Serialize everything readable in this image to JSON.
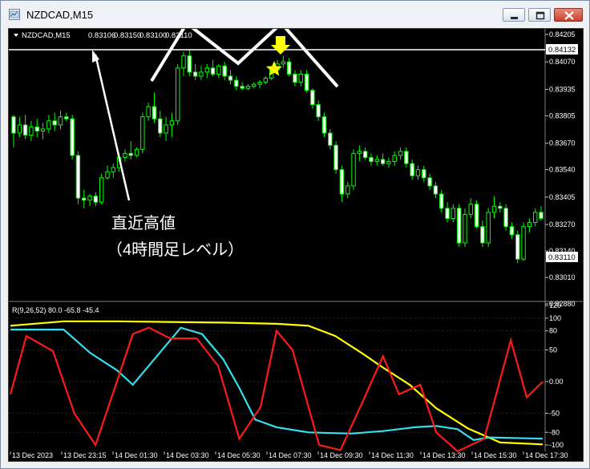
{
  "window": {
    "title": "NZDCAD,M15"
  },
  "chart_info": {
    "label": "NZDCAD,M15",
    "ohlc": [
      "0.83106",
      "0.83150",
      "0.83100",
      "0.83110"
    ]
  },
  "price_axis": {
    "ticks": [
      "0.84205",
      "0.84070",
      "0.83935",
      "0.83805",
      "0.83670",
      "0.83540",
      "0.83405",
      "0.83270",
      "0.83140",
      "0.83010",
      "0.82880"
    ],
    "high_label": "0.84132",
    "current_label": "0.83110"
  },
  "indicator": {
    "label": "R(9,26,52) 80.0 -65.8 -45.4",
    "ticks": [
      "120",
      "100",
      "80",
      "50",
      "0.00",
      "-50",
      "-80",
      "-100"
    ]
  },
  "time_axis": {
    "labels": [
      "13 Dec 2023",
      "13 Dec 23:15",
      "14 Dec 01:30",
      "14 Dec 03:30",
      "14 Dec 05:30",
      "14 Dec 07:30",
      "14 Dec 09:30",
      "14 Dec 11:30",
      "14 Dec 13:30",
      "14 Dec 15:30",
      "14 Dec 17:30"
    ]
  },
  "annotation": {
    "line1": "直近高値",
    "line2": "（4時間足レベル）"
  },
  "colors": {
    "candle": "#00ff00",
    "background": "#000000",
    "fast_line": "#ff1a1a",
    "mid_line": "#33e0f0",
    "slow_line": "#ffff00",
    "marker": "#ffff00"
  },
  "chart_data": {
    "type": "candlestick",
    "symbol": "NZDCAD",
    "timeframe": "M15",
    "y_range": [
      0.8288,
      0.8422
    ],
    "candles": [
      [
        0.838,
        0.8381,
        0.8365,
        0.8372
      ],
      [
        0.8372,
        0.838,
        0.837,
        0.8376
      ],
      [
        0.8376,
        0.8381,
        0.8369,
        0.8371
      ],
      [
        0.8371,
        0.8378,
        0.8368,
        0.8375
      ],
      [
        0.8375,
        0.8379,
        0.837,
        0.8373
      ],
      [
        0.8373,
        0.8377,
        0.8369,
        0.8374
      ],
      [
        0.8374,
        0.8381,
        0.8372,
        0.8378
      ],
      [
        0.8378,
        0.8382,
        0.8373,
        0.8376
      ],
      [
        0.8376,
        0.8383,
        0.8374,
        0.838
      ],
      [
        0.838,
        0.8382,
        0.8378,
        0.8379
      ],
      [
        0.8379,
        0.8381,
        0.8359,
        0.8361
      ],
      [
        0.8361,
        0.8363,
        0.8337,
        0.834
      ],
      [
        0.834,
        0.8344,
        0.8335,
        0.8339
      ],
      [
        0.8339,
        0.8342,
        0.8336,
        0.8341
      ],
      [
        0.8341,
        0.8343,
        0.8336,
        0.8338
      ],
      [
        0.8338,
        0.8352,
        0.8337,
        0.835
      ],
      [
        0.835,
        0.8356,
        0.8349,
        0.8353
      ],
      [
        0.8353,
        0.8357,
        0.835,
        0.8355
      ],
      [
        0.8355,
        0.8362,
        0.8353,
        0.836
      ],
      [
        0.836,
        0.8364,
        0.8358,
        0.8362
      ],
      [
        0.8362,
        0.8368,
        0.8359,
        0.8361
      ],
      [
        0.8361,
        0.8365,
        0.836,
        0.8364
      ],
      [
        0.8364,
        0.8382,
        0.8362,
        0.838
      ],
      [
        0.838,
        0.8387,
        0.8378,
        0.8385
      ],
      [
        0.8385,
        0.8392,
        0.8377,
        0.8379
      ],
      [
        0.8379,
        0.8383,
        0.837,
        0.8372
      ],
      [
        0.8372,
        0.838,
        0.8368,
        0.8376
      ],
      [
        0.8376,
        0.8382,
        0.837,
        0.8378
      ],
      [
        0.8378,
        0.8406,
        0.8376,
        0.8404
      ],
      [
        0.8404,
        0.8412,
        0.84,
        0.841
      ],
      [
        0.841,
        0.8413,
        0.84,
        0.8402
      ],
      [
        0.8402,
        0.8406,
        0.8398,
        0.84
      ],
      [
        0.84,
        0.8405,
        0.8398,
        0.8402
      ],
      [
        0.8402,
        0.8406,
        0.8399,
        0.8404
      ],
      [
        0.8404,
        0.8408,
        0.84,
        0.8401
      ],
      [
        0.8401,
        0.8406,
        0.8399,
        0.8405
      ],
      [
        0.8405,
        0.8407,
        0.8398,
        0.84
      ],
      [
        0.84,
        0.8403,
        0.8396,
        0.8398
      ],
      [
        0.8398,
        0.84,
        0.8393,
        0.8395
      ],
      [
        0.8395,
        0.8397,
        0.8393,
        0.8394
      ],
      [
        0.8394,
        0.8396,
        0.8393,
        0.8395
      ],
      [
        0.8395,
        0.8397,
        0.8394,
        0.8396
      ],
      [
        0.8396,
        0.8398,
        0.8394,
        0.8397
      ],
      [
        0.8397,
        0.84,
        0.8396,
        0.8399
      ],
      [
        0.8399,
        0.8404,
        0.8398,
        0.8403
      ],
      [
        0.8403,
        0.8408,
        0.8401,
        0.8406
      ],
      [
        0.8406,
        0.841,
        0.8404,
        0.8407
      ],
      [
        0.8407,
        0.8409,
        0.84,
        0.8401
      ],
      [
        0.8401,
        0.8403,
        0.8395,
        0.8397
      ],
      [
        0.8397,
        0.8403,
        0.8395,
        0.8401
      ],
      [
        0.8401,
        0.8403,
        0.8392,
        0.8393
      ],
      [
        0.8393,
        0.8394,
        0.8384,
        0.8386
      ],
      [
        0.8386,
        0.8388,
        0.8378,
        0.838
      ],
      [
        0.838,
        0.8382,
        0.837,
        0.8372
      ],
      [
        0.8372,
        0.8374,
        0.8364,
        0.8366
      ],
      [
        0.8366,
        0.8368,
        0.8352,
        0.8354
      ],
      [
        0.8354,
        0.8356,
        0.8338,
        0.8342
      ],
      [
        0.8342,
        0.8348,
        0.834,
        0.8346
      ],
      [
        0.8346,
        0.8364,
        0.8344,
        0.8362
      ],
      [
        0.8362,
        0.8366,
        0.8358,
        0.8363
      ],
      [
        0.8363,
        0.8365,
        0.8359,
        0.836
      ],
      [
        0.836,
        0.8362,
        0.8356,
        0.8358
      ],
      [
        0.8358,
        0.8361,
        0.8356,
        0.8359
      ],
      [
        0.8359,
        0.8362,
        0.8356,
        0.8357
      ],
      [
        0.8357,
        0.836,
        0.8355,
        0.8358
      ],
      [
        0.8358,
        0.8363,
        0.8356,
        0.8361
      ],
      [
        0.8361,
        0.8365,
        0.8359,
        0.8363
      ],
      [
        0.8363,
        0.8365,
        0.8355,
        0.8357
      ],
      [
        0.8357,
        0.8359,
        0.8349,
        0.8351
      ],
      [
        0.8351,
        0.8356,
        0.8349,
        0.8354
      ],
      [
        0.8354,
        0.8356,
        0.8348,
        0.835
      ],
      [
        0.835,
        0.8352,
        0.8344,
        0.8346
      ],
      [
        0.8346,
        0.8348,
        0.834,
        0.8342
      ],
      [
        0.8342,
        0.8344,
        0.8333,
        0.8335
      ],
      [
        0.8335,
        0.8338,
        0.8328,
        0.833
      ],
      [
        0.833,
        0.8337,
        0.8328,
        0.8335
      ],
      [
        0.8335,
        0.8337,
        0.8316,
        0.8318
      ],
      [
        0.8318,
        0.8335,
        0.8316,
        0.8332
      ],
      [
        0.8332,
        0.834,
        0.833,
        0.8337
      ],
      [
        0.8337,
        0.8339,
        0.8325,
        0.8326
      ],
      [
        0.8326,
        0.8329,
        0.8316,
        0.8318
      ],
      [
        0.8318,
        0.8335,
        0.8316,
        0.8333
      ],
      [
        0.8333,
        0.8341,
        0.833,
        0.8336
      ],
      [
        0.8336,
        0.8338,
        0.8333,
        0.8335
      ],
      [
        0.8335,
        0.8337,
        0.8324,
        0.8326
      ],
      [
        0.8326,
        0.8328,
        0.832,
        0.8322
      ],
      [
        0.8322,
        0.8324,
        0.8308,
        0.831
      ],
      [
        0.831,
        0.8328,
        0.8309,
        0.8326
      ],
      [
        0.8326,
        0.833,
        0.8323,
        0.8328
      ],
      [
        0.8328,
        0.8335,
        0.8326,
        0.8333
      ],
      [
        0.8333,
        0.8336,
        0.8329,
        0.833
      ]
    ],
    "indicator_range": [
      -110,
      120
    ],
    "indicator_series": [
      {
        "x": [
          0,
          0.05,
          0.12,
          0.2,
          0.28,
          0.36,
          0.4,
          0.44,
          0.48,
          0.52,
          0.56,
          0.6,
          0.64,
          0.68,
          0.72,
          0.78,
          0.82,
          0.86,
          0.9,
          0.94,
          0.98,
          1.02,
          1.06,
          1.1,
          1.14,
          1.18,
          1.22,
          1.26,
          1.3,
          1.34,
          1.38,
          1.42,
          1.46,
          1.5,
          1.54,
          1.58,
          1.62,
          1.66,
          1.7,
          1.74,
          1.78,
          1.82,
          1.86,
          1.9,
          1.94,
          1.98,
          2.02,
          2.06,
          2.1,
          2.14,
          2.18,
          2.22,
          2.26,
          2.3,
          2.34,
          2.38,
          2.42,
          2.46,
          2.5,
          2.54,
          2.58,
          2.62,
          2.66,
          2.7,
          2.74,
          2.78,
          2.82,
          2.86,
          2.9,
          2.94,
          2.98,
          3.02,
          3.06,
          3.1,
          3.14,
          3.18,
          3.22,
          3.26,
          3.3,
          3.34,
          3.38,
          3.42,
          3.46,
          3.5,
          3.54,
          3.58,
          3.62,
          3.66,
          3.7,
          3.74,
          3.78,
          3.82,
          3.86,
          3.9,
          3.94,
          3.98,
          4.02,
          4.06,
          4.1,
          4.14,
          4.18,
          4.22,
          4.26,
          4.3,
          4.34,
          4.38,
          4.42,
          4.46,
          4.5,
          4.54,
          4.58,
          4.62,
          4.66,
          4.7,
          4.74,
          4.78,
          4.82,
          4.86,
          4.9,
          4.94,
          4.98,
          5.02,
          5.06,
          5.1,
          5.14,
          5.18,
          5.22,
          5.26,
          5.3,
          5.34,
          5.38,
          5.42,
          5.46,
          5.5,
          5.54,
          5.58,
          5.62,
          5.66,
          5.7,
          5.74,
          5.78,
          5.82,
          5.86,
          5.9,
          5.94,
          5.98,
          6.02,
          6.06,
          6.1,
          6.14,
          6.18,
          6.22,
          6.26,
          6.3,
          6.34,
          6.38,
          6.42,
          6.46,
          6.5,
          6.54,
          6.58,
          6.62,
          6.66,
          6.7,
          6.74,
          6.78,
          6.82,
          6.86,
          6.9,
          6.94,
          6.98,
          7.02,
          7.06,
          7.1,
          7.14,
          7.18,
          7.22,
          7.26,
          7.3,
          7.34,
          7.38,
          7.42,
          7.46,
          7.5,
          7.54,
          7.58,
          7.62,
          7.66,
          7.7,
          7.74,
          7.78,
          7.82,
          7.86,
          7.9,
          7.94,
          7.98,
          8.02,
          8.06,
          8.1,
          8.14,
          8.18,
          8.22,
          8.26,
          8.3,
          8.34,
          8.38,
          8.42,
          8.46,
          8.5,
          8.54,
          8.58,
          8.62,
          8.66,
          8.7,
          8.74,
          8.78,
          8.82,
          8.86,
          8.9,
          8.94,
          8.98,
          9.02,
          9.06,
          9.1,
          9.14,
          9.18,
          9.22,
          9.26,
          9.3,
          9.34,
          9.38,
          9.42,
          9.46,
          9.5,
          9.54,
          9.58,
          9.62,
          9.66,
          9.7,
          9.74,
          9.78,
          9.82,
          9.86,
          9.9,
          9.94,
          9.98,
          10
        ],
        "values": []
      }
    ]
  }
}
